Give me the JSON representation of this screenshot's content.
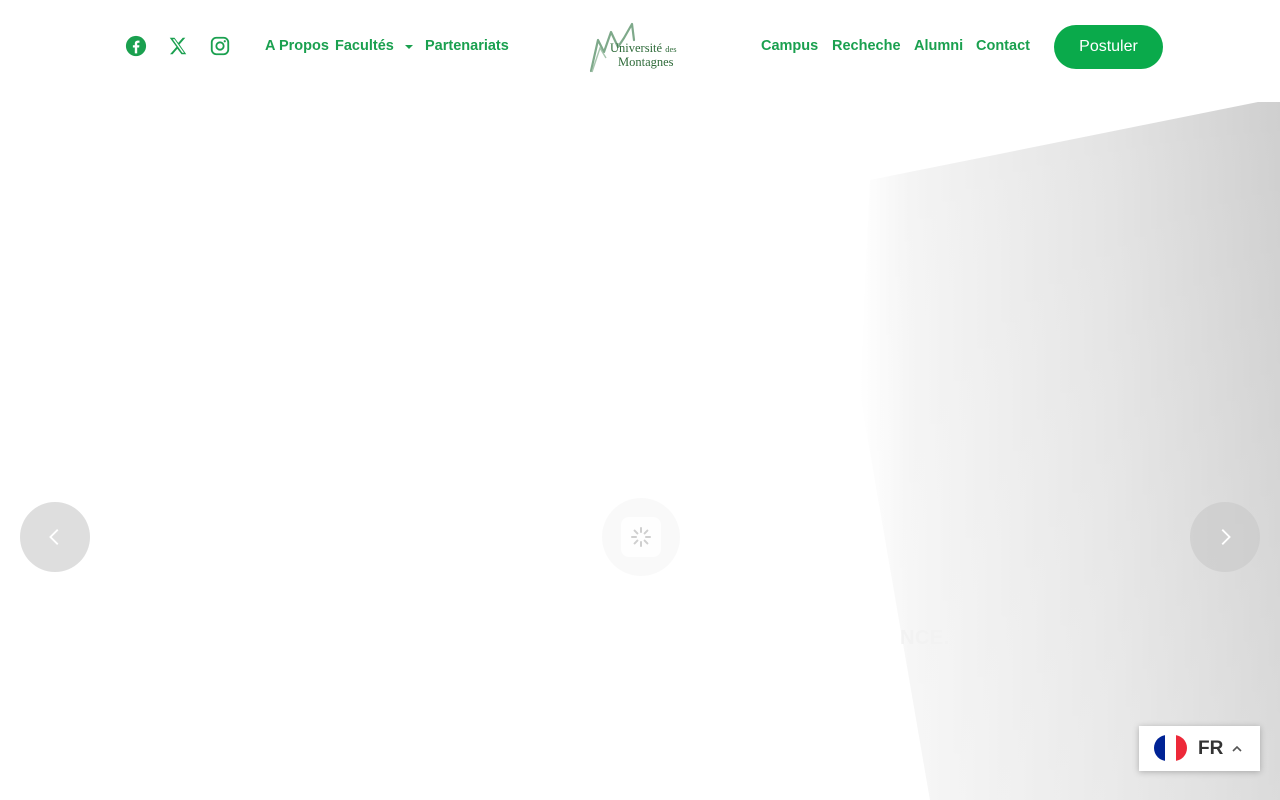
{
  "header": {
    "social": [
      {
        "icon": "facebook-icon"
      },
      {
        "icon": "x-twitter-icon"
      },
      {
        "icon": "instagram-icon"
      }
    ],
    "nav_left": [
      "A Propos",
      "Facultés",
      "Partenariats"
    ],
    "logo": {
      "line1": "Université",
      "line1_small": "des",
      "line2": "Montagnes"
    },
    "nav_right": [
      "Campus",
      "Recheche",
      "Alumni",
      "Contact"
    ],
    "cta_label": "Postuler"
  },
  "hero": {
    "caption": "NCE.",
    "prev_icon": "chevron-left-icon",
    "next_icon": "chevron-right-icon",
    "loader_icon": "spinner-icon"
  },
  "language": {
    "code": "FR",
    "flag_colors": [
      "#002395",
      "#ffffff",
      "#ed2939"
    ]
  },
  "colors": {
    "brand_green": "#0aaa4b",
    "nav_text": "#1aa04f",
    "logo_green": "#2f6b3a"
  }
}
